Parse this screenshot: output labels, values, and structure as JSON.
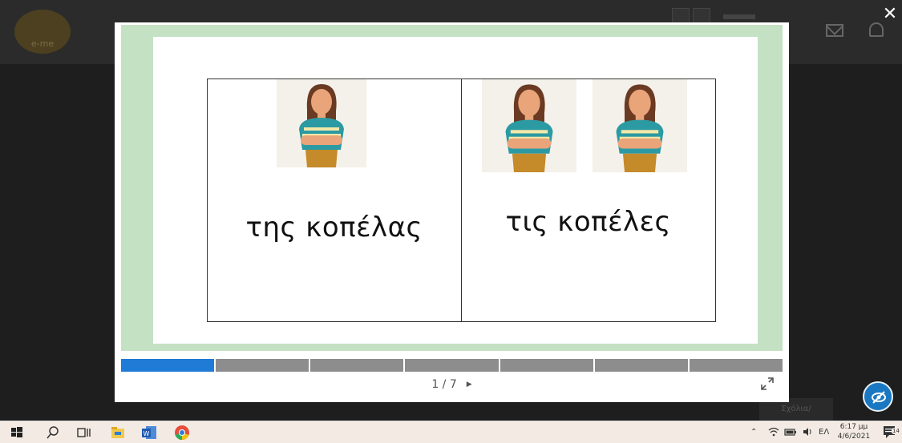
{
  "background": {
    "logo_text": "e-me",
    "status_text": "Σχόλια/Υποστήριξη"
  },
  "modal": {
    "slide": {
      "left_caption": "της κοπέλας",
      "right_caption": "τις κοπέλες"
    },
    "progress": {
      "current": 1,
      "total": 7
    },
    "pager_text": "1 / 7"
  },
  "taskbar": {
    "language": "ΕΛ",
    "time": "6:17 μμ",
    "date": "4/6/2021",
    "notifications": "14"
  },
  "colors": {
    "slide_frame": "#c5e1c4",
    "progress_active": "#1f7bd6",
    "progress_inactive": "#8d8d8d",
    "eye_button": "#1a78c2"
  },
  "icons": [
    "close-icon",
    "expand-icon",
    "hide-icon",
    "mail-icon",
    "bell-icon",
    "windows-start-icon",
    "search-icon",
    "task-view-icon",
    "file-explorer-icon",
    "word-icon",
    "chrome-icon",
    "chevron-up-icon",
    "wifi-icon",
    "battery-icon",
    "volume-icon",
    "notification-icon"
  ]
}
